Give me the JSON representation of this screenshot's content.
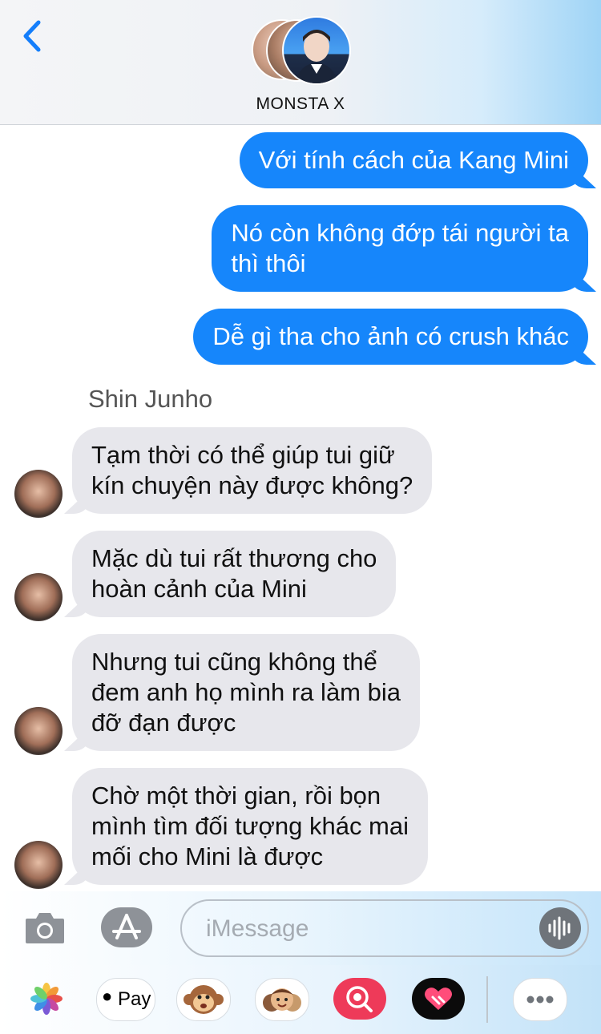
{
  "header": {
    "back_icon": "chevron-left-icon",
    "group_name": "MONSTA X"
  },
  "messages": [
    {
      "direction": "outgoing",
      "lines": [
        "Với tính cách của Kang Mini"
      ]
    },
    {
      "direction": "outgoing",
      "lines": [
        "Nó còn không đớp tái người ta",
        "thì thôi"
      ]
    },
    {
      "direction": "outgoing",
      "lines": [
        "Dễ gì tha cho ảnh có crush khác"
      ]
    },
    {
      "direction": "incoming",
      "sender": "Shin Junho",
      "lines": [
        "Tạm thời có thể giúp tui giữ",
        "kín chuyện này được không?"
      ]
    },
    {
      "direction": "incoming",
      "lines": [
        "Mặc dù tui rất thương cho",
        "hoàn cảnh của Mini"
      ]
    },
    {
      "direction": "incoming",
      "lines": [
        "Nhưng tui cũng không thể",
        "đem anh họ mình ra làm bia",
        "đỡ đạn được"
      ]
    },
    {
      "direction": "incoming",
      "lines": [
        "Chờ một thời gian, rồi bọn",
        "mình tìm đối tượng khác mai",
        "mối cho Mini là được"
      ]
    }
  ],
  "composer": {
    "camera_icon": "camera-icon",
    "apps_icon": "app-store-icon",
    "placeholder": "iMessage",
    "audio_icon": "audio-waveform-icon"
  },
  "app_drawer": {
    "apps": [
      {
        "name": "photos-icon"
      },
      {
        "name": "apple-pay-icon",
        "label": "Pay"
      },
      {
        "name": "animoji-monkey-icon"
      },
      {
        "name": "memoji-icon"
      },
      {
        "name": "image-search-icon"
      },
      {
        "name": "digital-touch-icon"
      },
      {
        "name": "more-apps-icon"
      }
    ]
  },
  "colors": {
    "outgoing_bubble": "#1686fb",
    "incoming_bubble": "#e7e7ec",
    "accent_blue": "#147efb"
  }
}
